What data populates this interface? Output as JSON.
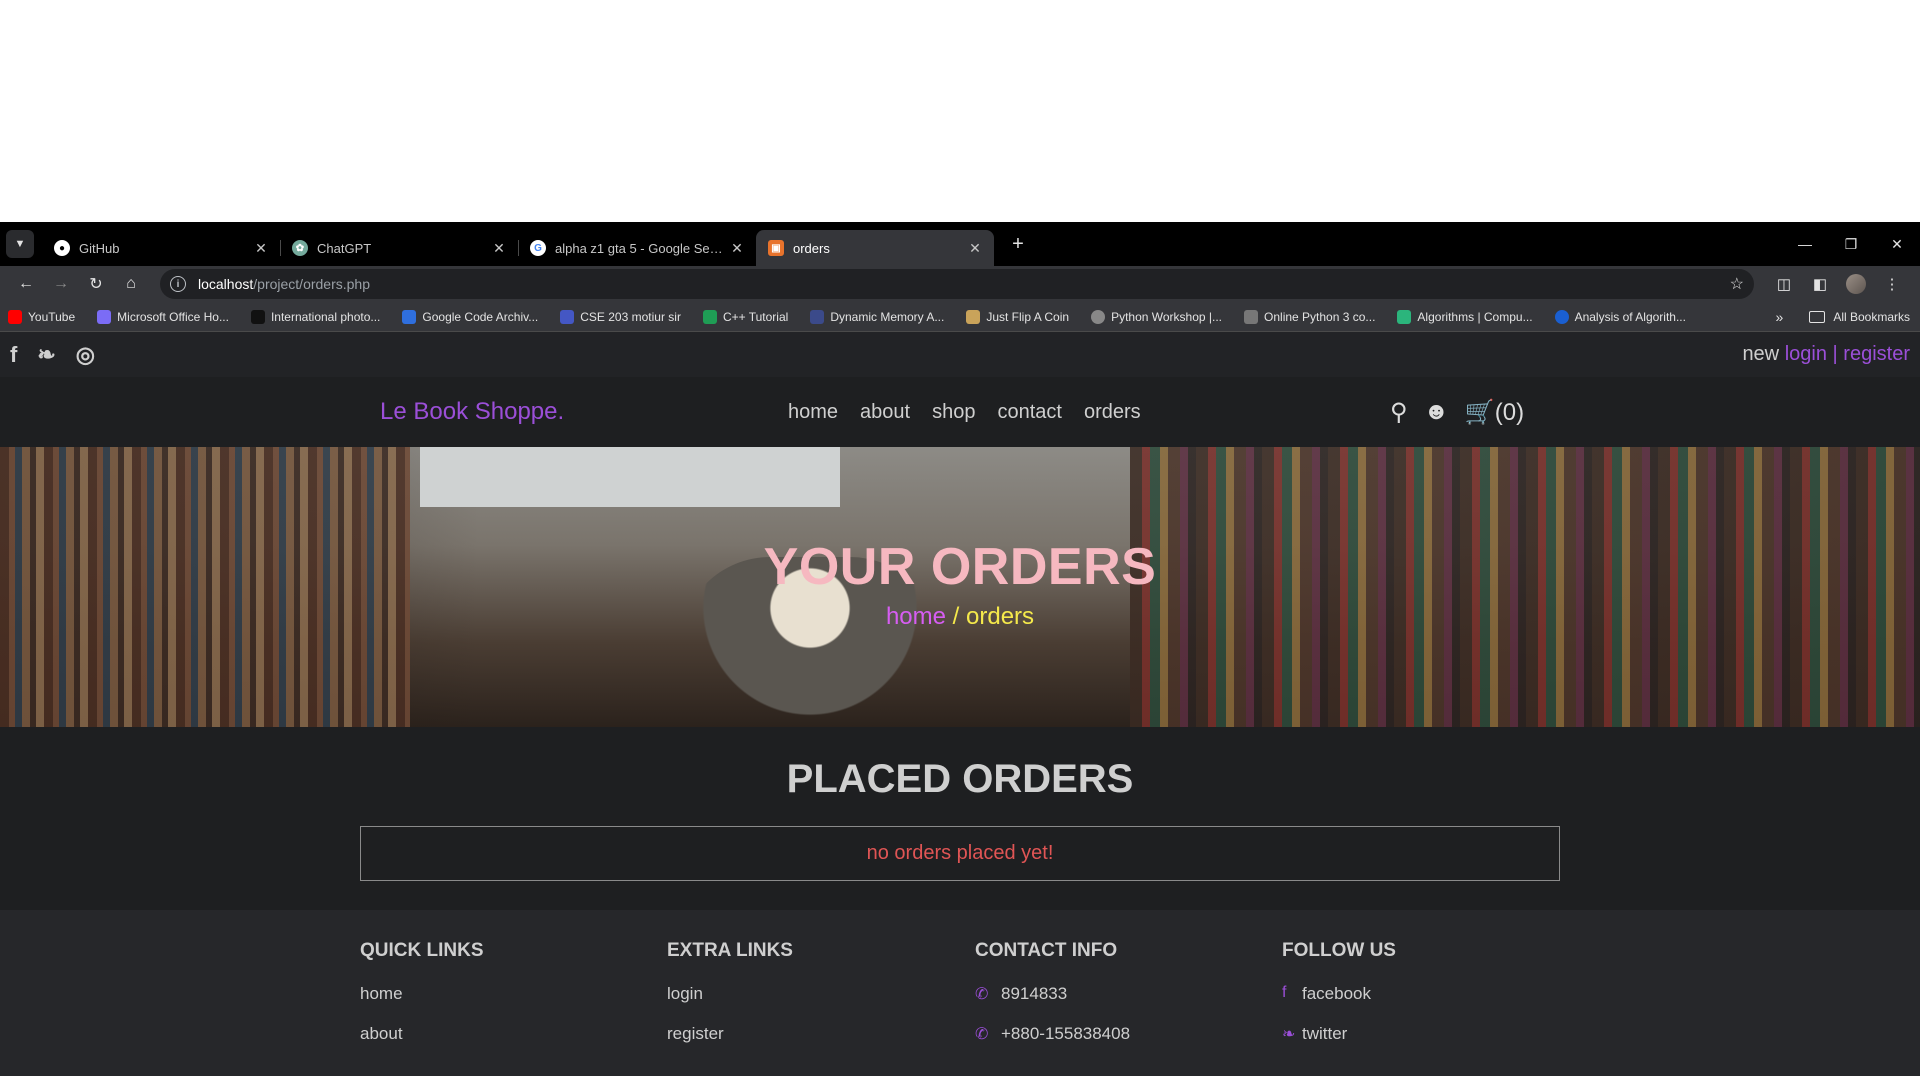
{
  "browser": {
    "tabs": [
      {
        "title": "GitHub",
        "icon": "github-icon"
      },
      {
        "title": "ChatGPT",
        "icon": "chatgpt-icon"
      },
      {
        "title": "alpha z1 gta 5 - Google Search",
        "icon": "google-icon"
      },
      {
        "title": "orders",
        "icon": "site-icon",
        "active": true
      }
    ],
    "url_host": "localhost",
    "url_path": "/project/orders.php",
    "bookmarks": [
      "YouTube",
      "Microsoft Office Ho...",
      "International photo...",
      "Google Code Archiv...",
      "CSE 203 motiur sir",
      "C++ Tutorial",
      "Dynamic Memory A...",
      "Just Flip A Coin",
      "Python Workshop |...",
      "Online Python 3 co...",
      "Algorithms | Compu...",
      "Analysis of Algorith..."
    ],
    "all_bookmarks": "All Bookmarks"
  },
  "site": {
    "auth": {
      "prefix": "new",
      "login": "login",
      "sep": "|",
      "register": "register"
    },
    "logo": "Le Book Shoppe.",
    "nav": [
      "home",
      "about",
      "shop",
      "contact",
      "orders"
    ],
    "cart_count": "(0)",
    "hero": {
      "title": "YOUR ORDERS",
      "crumb_home": "home",
      "crumb_sep": " / ",
      "crumb_current": "orders"
    },
    "orders": {
      "title": "PLACED ORDERS",
      "empty_message": "no orders placed yet!"
    },
    "footer": {
      "quick_links": {
        "title": "QUICK LINKS",
        "items": [
          "home",
          "about"
        ]
      },
      "extra_links": {
        "title": "EXTRA LINKS",
        "items": [
          "login",
          "register"
        ]
      },
      "contact": {
        "title": "CONTACT INFO",
        "items": [
          "8914833",
          "+880-155838408"
        ]
      },
      "follow": {
        "title": "FOLLOW US",
        "items": [
          "facebook",
          "twitter"
        ]
      }
    }
  },
  "colors": {
    "accent": "#9b4fd8",
    "hero_title": "#f6b8c0",
    "crumb_current": "#f5e94b",
    "empty": "#e05555"
  }
}
